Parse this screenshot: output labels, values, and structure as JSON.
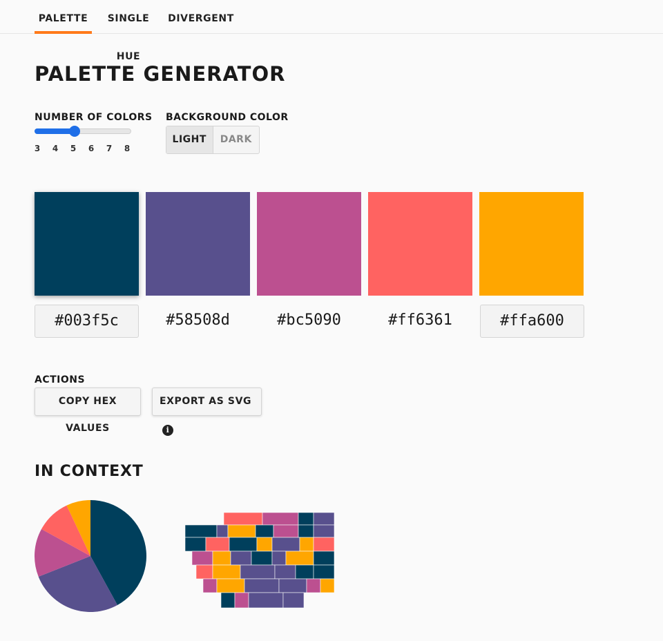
{
  "tabs": [
    {
      "label": "PALETTE",
      "active": true
    },
    {
      "label": "SINGLE HUE",
      "active": false
    },
    {
      "label": "DIVERGENT",
      "active": false
    }
  ],
  "page_title": "PALETTE GENERATOR",
  "number_of_colors": {
    "label": "NUMBER OF COLORS",
    "ticks": [
      "3",
      "4",
      "5",
      "6",
      "7",
      "8"
    ],
    "value": 5
  },
  "background_color": {
    "label": "BACKGROUND COLOR",
    "options": [
      "LIGHT",
      "DARK"
    ],
    "selected": "LIGHT"
  },
  "swatches": [
    {
      "hex": "#003f5c"
    },
    {
      "hex": "#58508d"
    },
    {
      "hex": "#bc5090"
    },
    {
      "hex": "#ff6361"
    },
    {
      "hex": "#ffa600"
    }
  ],
  "actions": {
    "label": "ACTIONS",
    "copy_label": "COPY HEX VALUES",
    "export_label": "EXPORT AS SVG"
  },
  "context": {
    "title": "IN CONTEXT"
  },
  "colors": {
    "accent_tab": "#ff7a1a",
    "slider": "#1f6fe8"
  },
  "icons": {
    "export_info": "info-icon"
  }
}
